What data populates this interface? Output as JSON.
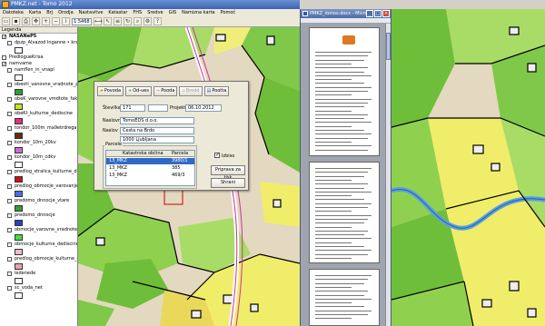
{
  "app": {
    "title": "PMKZ.net - Tomo 2012",
    "menu": [
      "Datoteka",
      "Karta",
      "Brj",
      "Orodja",
      "Nastavitve",
      "Katastar",
      "FHS",
      "Sredve",
      "GIS",
      "Namizna karta",
      "Pomoč"
    ],
    "scale_value": "1:5468"
  },
  "legend": {
    "header": "Legenda",
    "items": [
      {
        "label": "NASANeP5",
        "checked": true,
        "indent": 0,
        "bold": true
      },
      {
        "label": "dpzp_Alvazod Inganne • kradnik",
        "checked": false,
        "indent": 3,
        "swatch": "#ffffff"
      },
      {
        "label": "PredlogueKrisa",
        "checked": false,
        "indent": 0
      },
      {
        "label": "namvame",
        "checked": true,
        "indent": 0
      },
      {
        "label": "namflen_in_vnapi",
        "checked": false,
        "indent": 3,
        "swatch": "#ffffff"
      },
      {
        "label": "obeoti_vanovne_vradnote_pitovnve",
        "checked": false,
        "indent": 3,
        "swatch": "#2fa02f"
      },
      {
        "label": "obeK_varovne_vmdtote_fakalnop",
        "checked": false,
        "indent": 3,
        "swatch": "#c8e61a"
      },
      {
        "label": "obeKt_kulturne_dediscine",
        "checked": false,
        "indent": 3,
        "swatch": "#e0307f"
      },
      {
        "label": "tondor_100m_ma9etrdrega_pnovv",
        "checked": false,
        "indent": 3,
        "swatch": "#6b2c0e"
      },
      {
        "label": "kondor_10m_20kv",
        "checked": false,
        "indent": 3,
        "swatch": "#d06bd0"
      },
      {
        "label": "kondor_10m_cdkv",
        "checked": false,
        "indent": 3,
        "swatch": "#ffffff"
      },
      {
        "label": "predlog_stralica_kulturne_dediscine",
        "checked": false,
        "indent": 3,
        "swatch": "#cc1111"
      },
      {
        "label": "predlog_obmocje_varovanje_vrede",
        "checked": false,
        "indent": 3,
        "swatch": "#4a6ee0"
      },
      {
        "label": "predomo_dnnocje_vtare",
        "checked": false,
        "indent": 3,
        "swatch": "#2fa02f"
      },
      {
        "label": "predomo_dnnocje",
        "checked": false,
        "indent": 3,
        "swatch": "#2c3fb5"
      },
      {
        "label": "obmocje_varovne_vradnote",
        "checked": false,
        "indent": 3,
        "swatch": "#44dd44"
      },
      {
        "label": "obmocje_kulturne_dediscine",
        "checked": false,
        "indent": 3,
        "swatch": "#f6b8c8"
      },
      {
        "label": "predlog_obmocje_kulturne_dediscine",
        "checked": false,
        "indent": 3,
        "swatch": "#eea0b0"
      },
      {
        "label": "ledenede",
        "checked": false,
        "indent": 3,
        "swatch": "#ffffff"
      },
      {
        "label": "sc_voda_net",
        "checked": false,
        "indent": 3,
        "swatch": "#ffffff"
      }
    ]
  },
  "word": {
    "title": "PMKZ_donos.docx - Micro..."
  },
  "dialog": {
    "buttons": [
      {
        "label": "Povoda",
        "icon": "folder"
      },
      {
        "label": "Od-ues",
        "icon": "plus"
      },
      {
        "label": "Pooda",
        "icon": "minus"
      },
      {
        "label": "Brodd",
        "icon": "trash",
        "disabled": true
      },
      {
        "label": "Pootta",
        "icon": "doc"
      }
    ],
    "fields": {
      "stevilka_label": "Številka",
      "stevilka_value": "171",
      "projekt_label": "Projekt",
      "projekt_value": "06.10.2012",
      "naslovnik_label": "Naslovnik",
      "naslovnik_value": "TomoEDS d.o.o.",
      "naslov_label": "Naslov",
      "naslov_value": "Cesta na Brdo",
      "posta_value": "1000 Ljubljana"
    },
    "group_label": "Parcele",
    "grid": {
      "columns": [
        "",
        "Katastrska občina",
        "Parcela"
      ],
      "rows": [
        {
          "ko": "13_MKZ",
          "parcela": "3980/1",
          "selected": true
        },
        {
          "ko": "13_MKZ",
          "parcela": "385",
          "selected": false
        },
        {
          "ko": "13_MKZ",
          "parcela": "469/3",
          "selected": false
        }
      ]
    },
    "checkbox_label": "Izbiso",
    "checkbox_checked": true,
    "btn_report": "Priprava za tisk",
    "btn_close": "Shrani"
  }
}
